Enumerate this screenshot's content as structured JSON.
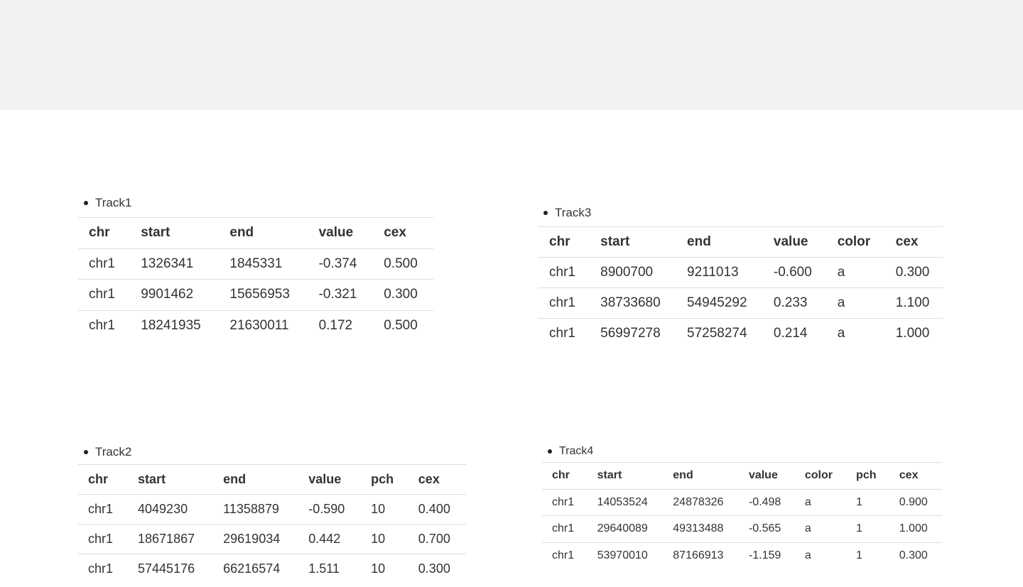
{
  "tracks": {
    "track1": {
      "title": "Track1",
      "headers": [
        "chr",
        "start",
        "end",
        "value",
        "cex"
      ],
      "rows": [
        [
          "chr1",
          "1326341",
          "1845331",
          "-0.374",
          "0.500"
        ],
        [
          "chr1",
          "9901462",
          "15656953",
          "-0.321",
          "0.300"
        ],
        [
          "chr1",
          "18241935",
          "21630011",
          "0.172",
          "0.500"
        ]
      ]
    },
    "track2": {
      "title": "Track2",
      "headers": [
        "chr",
        "start",
        "end",
        "value",
        "pch",
        "cex"
      ],
      "rows": [
        [
          "chr1",
          "4049230",
          "11358879",
          "-0.590",
          "10",
          "0.400"
        ],
        [
          "chr1",
          "18671867",
          "29619034",
          "0.442",
          "10",
          "0.700"
        ],
        [
          "chr1",
          "57445176",
          "66216574",
          "1.511",
          "10",
          "0.300"
        ]
      ]
    },
    "track3": {
      "title": "Track3",
      "headers": [
        "chr",
        "start",
        "end",
        "value",
        "color",
        "cex"
      ],
      "rows": [
        [
          "chr1",
          "8900700",
          "9211013",
          "-0.600",
          "a",
          "0.300"
        ],
        [
          "chr1",
          "38733680",
          "54945292",
          "0.233",
          "a",
          "1.100"
        ],
        [
          "chr1",
          "56997278",
          "57258274",
          "0.214",
          "a",
          "1.000"
        ]
      ]
    },
    "track4": {
      "title": "Track4",
      "headers": [
        "chr",
        "start",
        "end",
        "value",
        "color",
        "pch",
        "cex"
      ],
      "rows": [
        [
          "chr1",
          "14053524",
          "24878326",
          "-0.498",
          "a",
          "1",
          "0.900"
        ],
        [
          "chr1",
          "29640089",
          "49313488",
          "-0.565",
          "a",
          "1",
          "1.000"
        ],
        [
          "chr1",
          "53970010",
          "87166913",
          "-1.159",
          "a",
          "1",
          "0.300"
        ]
      ]
    }
  }
}
